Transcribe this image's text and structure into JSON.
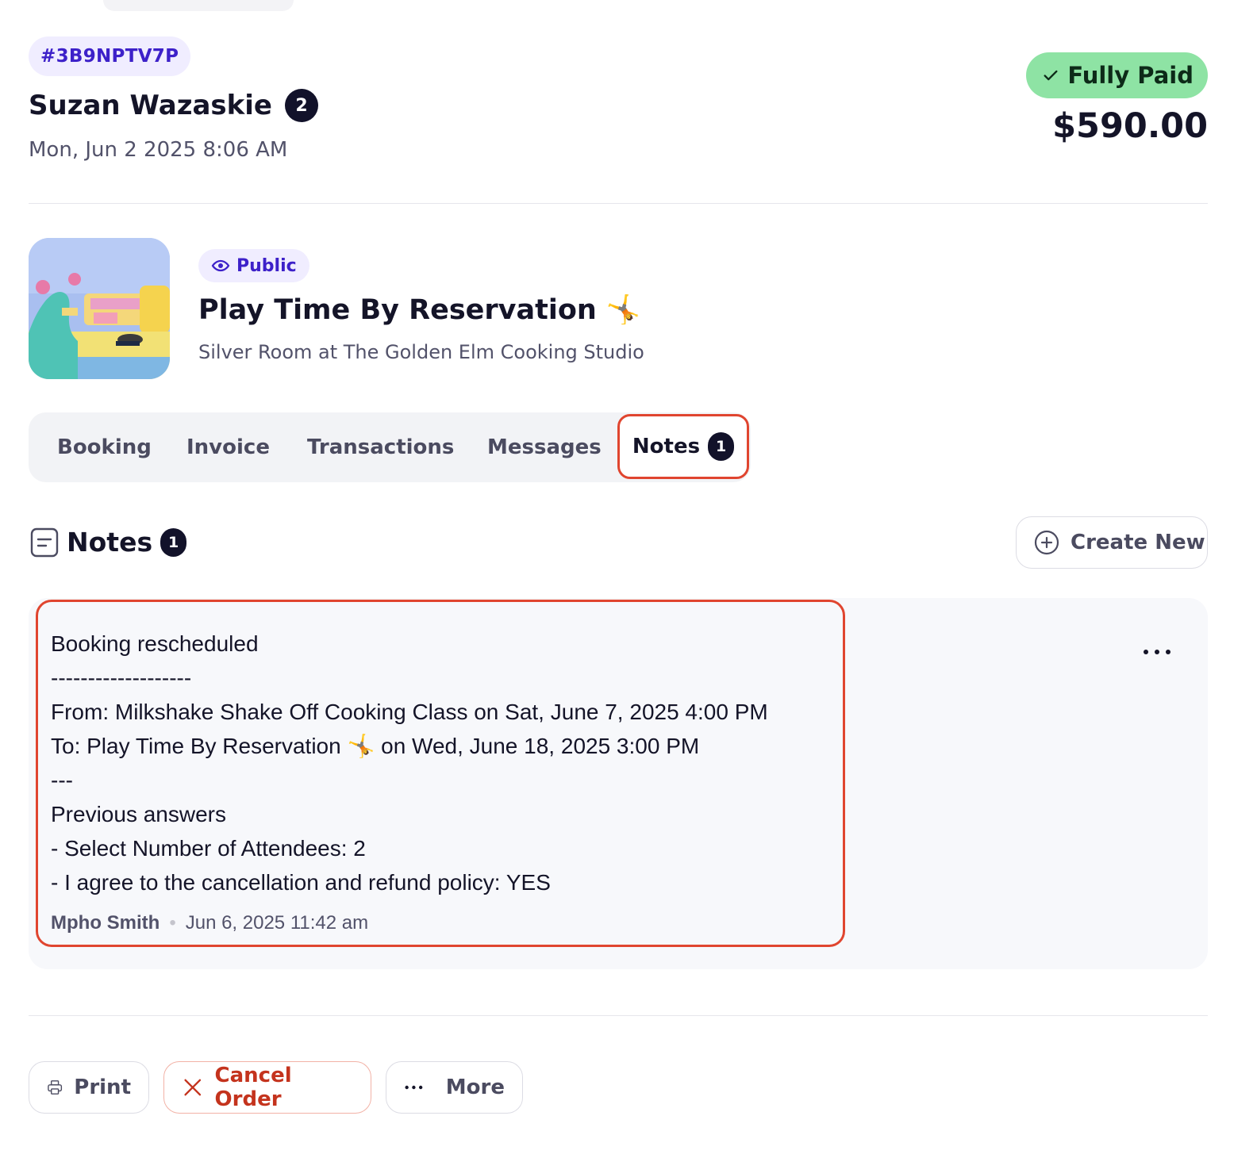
{
  "order": {
    "id": "#3B9NPTV7P",
    "customer_name": "Suzan Wazaskie",
    "attendee_count": "2",
    "date": "Mon, Jun 2 2025 8:06 AM",
    "payment_status": "Fully Paid",
    "total": "$590.00"
  },
  "event": {
    "visibility": "Public",
    "title": "Play Time By Reservation",
    "title_emoji": "🤸",
    "venue": "Silver Room at The Golden Elm Cooking Studio"
  },
  "tabs": [
    {
      "label": "Booking"
    },
    {
      "label": "Invoice"
    },
    {
      "label": "Transactions"
    },
    {
      "label": "Messages"
    },
    {
      "label": "Notes",
      "count": "1",
      "active": true
    }
  ],
  "notes_section": {
    "heading": "Notes",
    "count": "1",
    "create_label": "Create New"
  },
  "notes": [
    {
      "body": "Booking rescheduled\n-------------------\nFrom: Milkshake Shake Off Cooking Class on Sat, June 7, 2025 4:00 PM\nTo: Play Time By Reservation 🤸 on Wed, June 18, 2025 3:00 PM\n---\nPrevious answers\n- Select Number of Attendees: 2\n- I agree to the cancellation and refund policy: YES",
      "author": "Mpho Smith",
      "separator": "•",
      "timestamp": "Jun 6, 2025 11:42 am"
    }
  ],
  "actions": {
    "print": "Print",
    "cancel": "Cancel Order",
    "more": "More"
  },
  "colors": {
    "accent_purple": "#3d21c9",
    "highlight_red": "#e0452f",
    "paid_green": "#8ee3a4",
    "danger": "#c4331d"
  },
  "icons": [
    "check-icon",
    "eye-icon",
    "note-icon",
    "plus-circle-icon",
    "ellipsis-icon",
    "printer-icon",
    "close-icon"
  ]
}
